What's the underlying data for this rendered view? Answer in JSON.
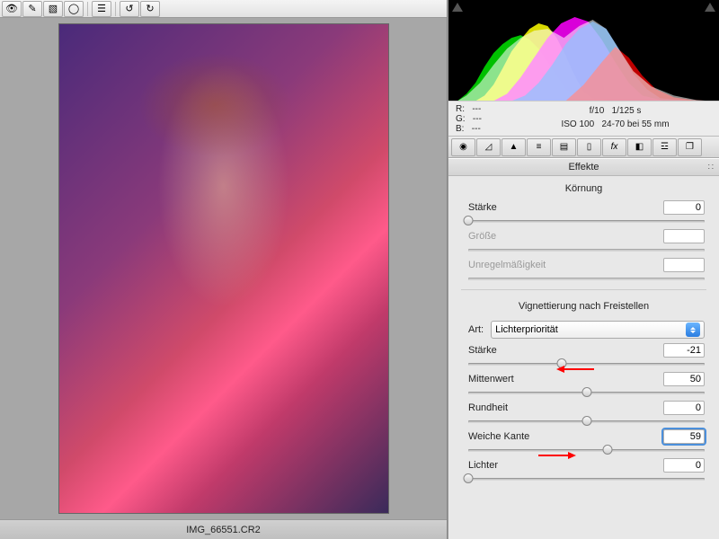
{
  "filename": "IMG_66551.CR2",
  "rgb": {
    "r_label": "R:",
    "g_label": "G:",
    "b_label": "B:",
    "dash": "---"
  },
  "exif": {
    "aperture": "f/10",
    "shutter": "1/125 s",
    "iso": "ISO 100",
    "lens": "24-70 bei 55 mm"
  },
  "panel_title": "Effekte",
  "grain": {
    "title": "Körnung",
    "strength_label": "Stärke",
    "strength_value": "0",
    "size_label": "Größe",
    "size_value": "",
    "rough_label": "Unregelmäßigkeit",
    "rough_value": ""
  },
  "vignette": {
    "title": "Vignettierung nach Freistellen",
    "art_label": "Art:",
    "art_value": "Lichterpriorität",
    "strength_label": "Stärke",
    "strength_value": "-21",
    "midpoint_label": "Mittenwert",
    "midpoint_value": "50",
    "roundness_label": "Rundheit",
    "roundness_value": "0",
    "feather_label": "Weiche Kante",
    "feather_value": "59",
    "highlights_label": "Lichter",
    "highlights_value": "0"
  },
  "toolbar_icons": [
    "eye-icon",
    "brush-icon",
    "layers-icon",
    "oval-icon",
    "list-icon",
    "rotate-ccw-icon",
    "rotate-cw-icon"
  ],
  "panel_tab_icons": [
    "basic-icon",
    "curves-icon",
    "detail-icon",
    "hsl-icon",
    "split-icon",
    "lens-icon",
    "fx-icon",
    "camera-icon",
    "sliders-icon",
    "presets-icon"
  ]
}
